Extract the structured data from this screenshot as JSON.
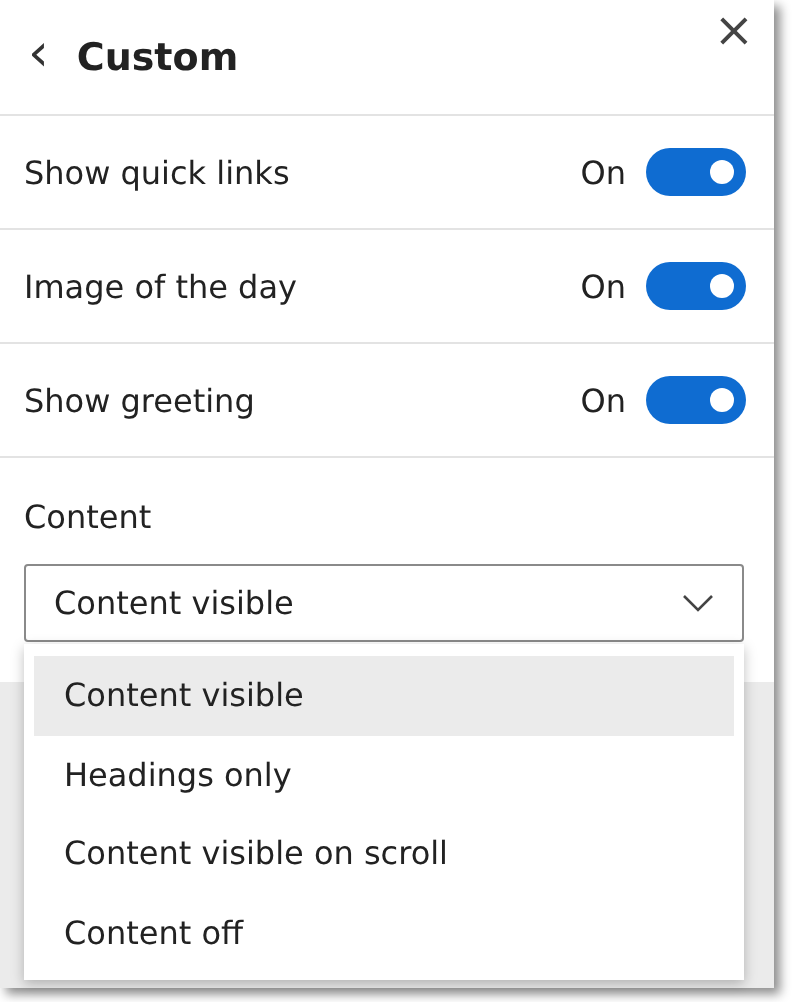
{
  "header": {
    "back": "‹",
    "title": "Custom",
    "close": "×"
  },
  "settings": [
    {
      "label": "Show quick links",
      "state_text": "On",
      "on": true
    },
    {
      "label": "Image of the day",
      "state_text": "On",
      "on": true
    },
    {
      "label": "Show greeting",
      "state_text": "On",
      "on": true
    }
  ],
  "content": {
    "label": "Content",
    "value": "Content visible",
    "expanded": true,
    "options": [
      {
        "label": "Content visible",
        "selected": true
      },
      {
        "label": "Headings only",
        "selected": false
      },
      {
        "label": "Content visible on scroll",
        "selected": false
      },
      {
        "label": "Content off",
        "selected": false
      }
    ]
  }
}
